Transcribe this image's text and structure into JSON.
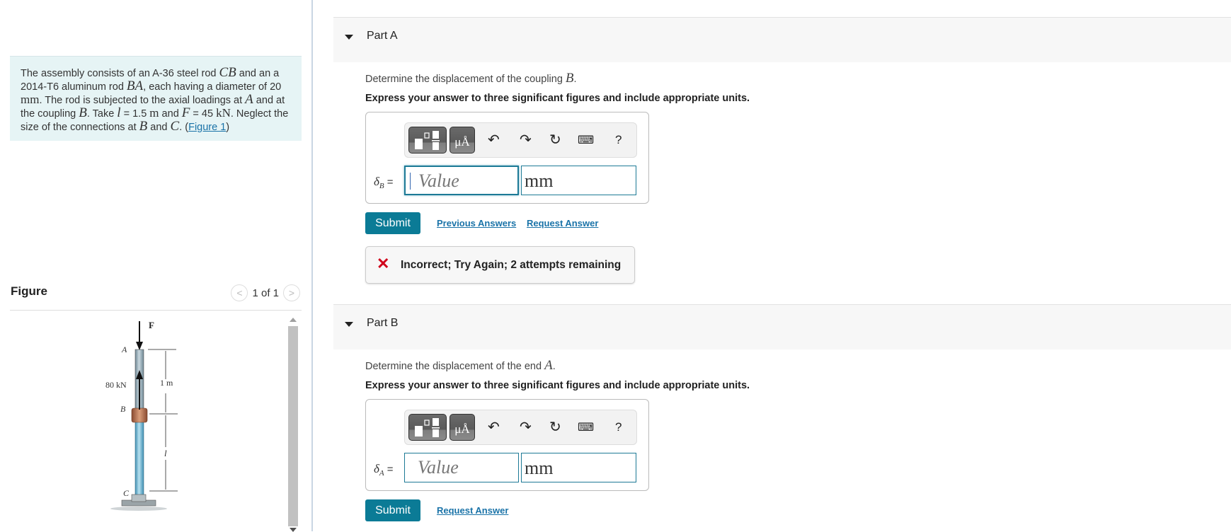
{
  "problem": {
    "segments": [
      {
        "t": "The assembly consists of an A-36 steel rod "
      },
      {
        "m": "CB"
      },
      {
        "t": " and an a 2014-T6 aluminum rod "
      },
      {
        "m": "BA"
      },
      {
        "t": ", each having a diameter of 20 "
      },
      {
        "r": "mm"
      },
      {
        "t": ". The rod is subjected to the axial loadings at "
      },
      {
        "m": "A"
      },
      {
        "t": " and at the coupling "
      },
      {
        "m": "B"
      },
      {
        "t": ". Take "
      },
      {
        "m": "l"
      },
      {
        "t": " = 1.5 "
      },
      {
        "r": "m"
      },
      {
        "t": " and "
      },
      {
        "m": "F"
      },
      {
        "t": " = 45 "
      },
      {
        "r": "kN"
      },
      {
        "t": ". Neglect the size of the connections at "
      },
      {
        "m": "B"
      },
      {
        "t": " and "
      },
      {
        "m": "C"
      },
      {
        "t": ". ("
      }
    ],
    "figure_link": "Figure 1",
    "close_paren": ")"
  },
  "figure": {
    "title": "Figure",
    "pager": "1 of 1",
    "prev_icon": "chevron-left-icon",
    "next_icon": "chevron-right-icon",
    "labels": {
      "F": "F",
      "A": "A",
      "load": "80 kN",
      "B": "B",
      "C": "C",
      "len1": "1 m",
      "len2": "l"
    }
  },
  "parts": [
    {
      "label": "Part A",
      "question_pre": "Determine the displacement of the coupling ",
      "question_var": "B",
      "question_post": ".",
      "instruction": "Express your answer to three significant figures and include appropriate units.",
      "field_label_sym": "δ",
      "field_label_sub": "B",
      "field_label_eq": " =",
      "value_placeholder": "Value",
      "unit": "mm",
      "submit": "Submit",
      "links": [
        "Previous Answers",
        "Request Answer"
      ],
      "feedback": "Incorrect; Try Again; 2 attempts remaining"
    },
    {
      "label": "Part B",
      "question_pre": "Determine the displacement of the end ",
      "question_var": "A",
      "question_post": ".",
      "instruction": "Express your answer to three significant figures and include appropriate units.",
      "field_label_sym": "δ",
      "field_label_sub": "A",
      "field_label_eq": " =",
      "value_placeholder": "Value",
      "unit": "mm",
      "submit": "Submit",
      "links": [
        "Request Answer"
      ]
    }
  ],
  "toolbar": {
    "units_button": "μÅ",
    "help": "?",
    "icons": [
      "templates-icon",
      "units-icon",
      "undo-icon",
      "redo-icon",
      "reset-icon",
      "keyboard-icon",
      "help-icon"
    ]
  },
  "colors": {
    "accent": "#0b7b96",
    "link": "#1a73a8",
    "error": "#d0021b",
    "problem_bg": "#e6f4f5"
  }
}
